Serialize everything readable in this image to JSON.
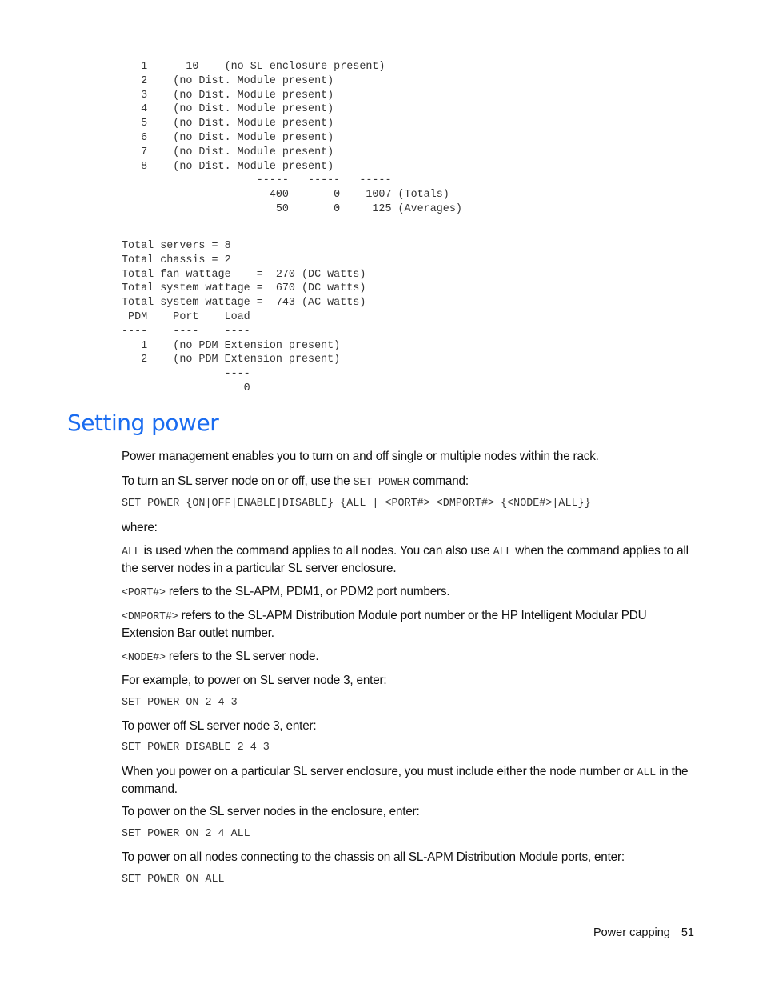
{
  "code_output": {
    "block1_lines": [
      "   1      10    (no SL enclosure present)",
      "   2    (no Dist. Module present)",
      "   3    (no Dist. Module present)",
      "   4    (no Dist. Module present)",
      "   5    (no Dist. Module present)",
      "   6    (no Dist. Module present)",
      "   7    (no Dist. Module present)",
      "   8    (no Dist. Module present)",
      "                     -----   -----   -----",
      "                       400       0    1007 (Totals)",
      "                        50       0     125 (Averages)"
    ],
    "block2_lines": [
      "Total servers = 8",
      "Total chassis = 2",
      "Total fan wattage    =  270 (DC watts)",
      "Total system wattage =  670 (DC watts)",
      "Total system wattage =  743 (AC watts)",
      " PDM    Port    Load",
      "----    ----    ----",
      "   1    (no PDM Extension present)",
      "   2    (no PDM Extension present)",
      "                ----",
      "                   0"
    ]
  },
  "section": {
    "title": "Setting power",
    "p1": "Power management enables you to turn on and off single or multiple nodes within the rack.",
    "p2_pre": "To turn an SL server node on or off, use the ",
    "p2_code": "SET POWER",
    "p2_post": " command:",
    "syntax": "SET POWER {ON|OFF|ENABLE|DISABLE} {ALL | <PORT#> <DMPORT#> {<NODE#>|ALL}}",
    "where": "where:",
    "all_code": "ALL",
    "all_text1": " is used when the command applies to all nodes. You can also use ",
    "all_code2": "ALL",
    "all_text2": " when the command applies to all the server nodes in a particular SL server enclosure.",
    "port_code": "<PORT#>",
    "port_text": " refers to the SL-APM, PDM1, or PDM2 port numbers.",
    "dmport_code": "<DMPORT#>",
    "dmport_text": " refers to the SL-APM Distribution Module port number or the HP Intelligent Modular PDU Extension Bar outlet number.",
    "node_code": "<NODE#>",
    "node_text": " refers to the SL server node.",
    "ex1_text": "For example, to power on SL server node 3, enter:",
    "ex1_cmd": "SET POWER ON 2 4 3",
    "ex2_text": "To power off SL server node 3, enter:",
    "ex2_cmd": "SET POWER DISABLE 2 4 3",
    "note_pre": "When you power on a particular SL server enclosure, you must include either the node number or ",
    "note_code": "ALL",
    "note_post": " in the command.",
    "ex3_text": "To power on the SL server nodes in the enclosure, enter:",
    "ex3_cmd": "SET POWER ON 2 4 ALL",
    "ex4_text": "To power on all nodes connecting to the chassis on all SL-APM Distribution Module ports, enter:",
    "ex4_cmd": "SET POWER ON ALL"
  },
  "footer": {
    "chapter": "Power capping",
    "page_number": "51"
  }
}
